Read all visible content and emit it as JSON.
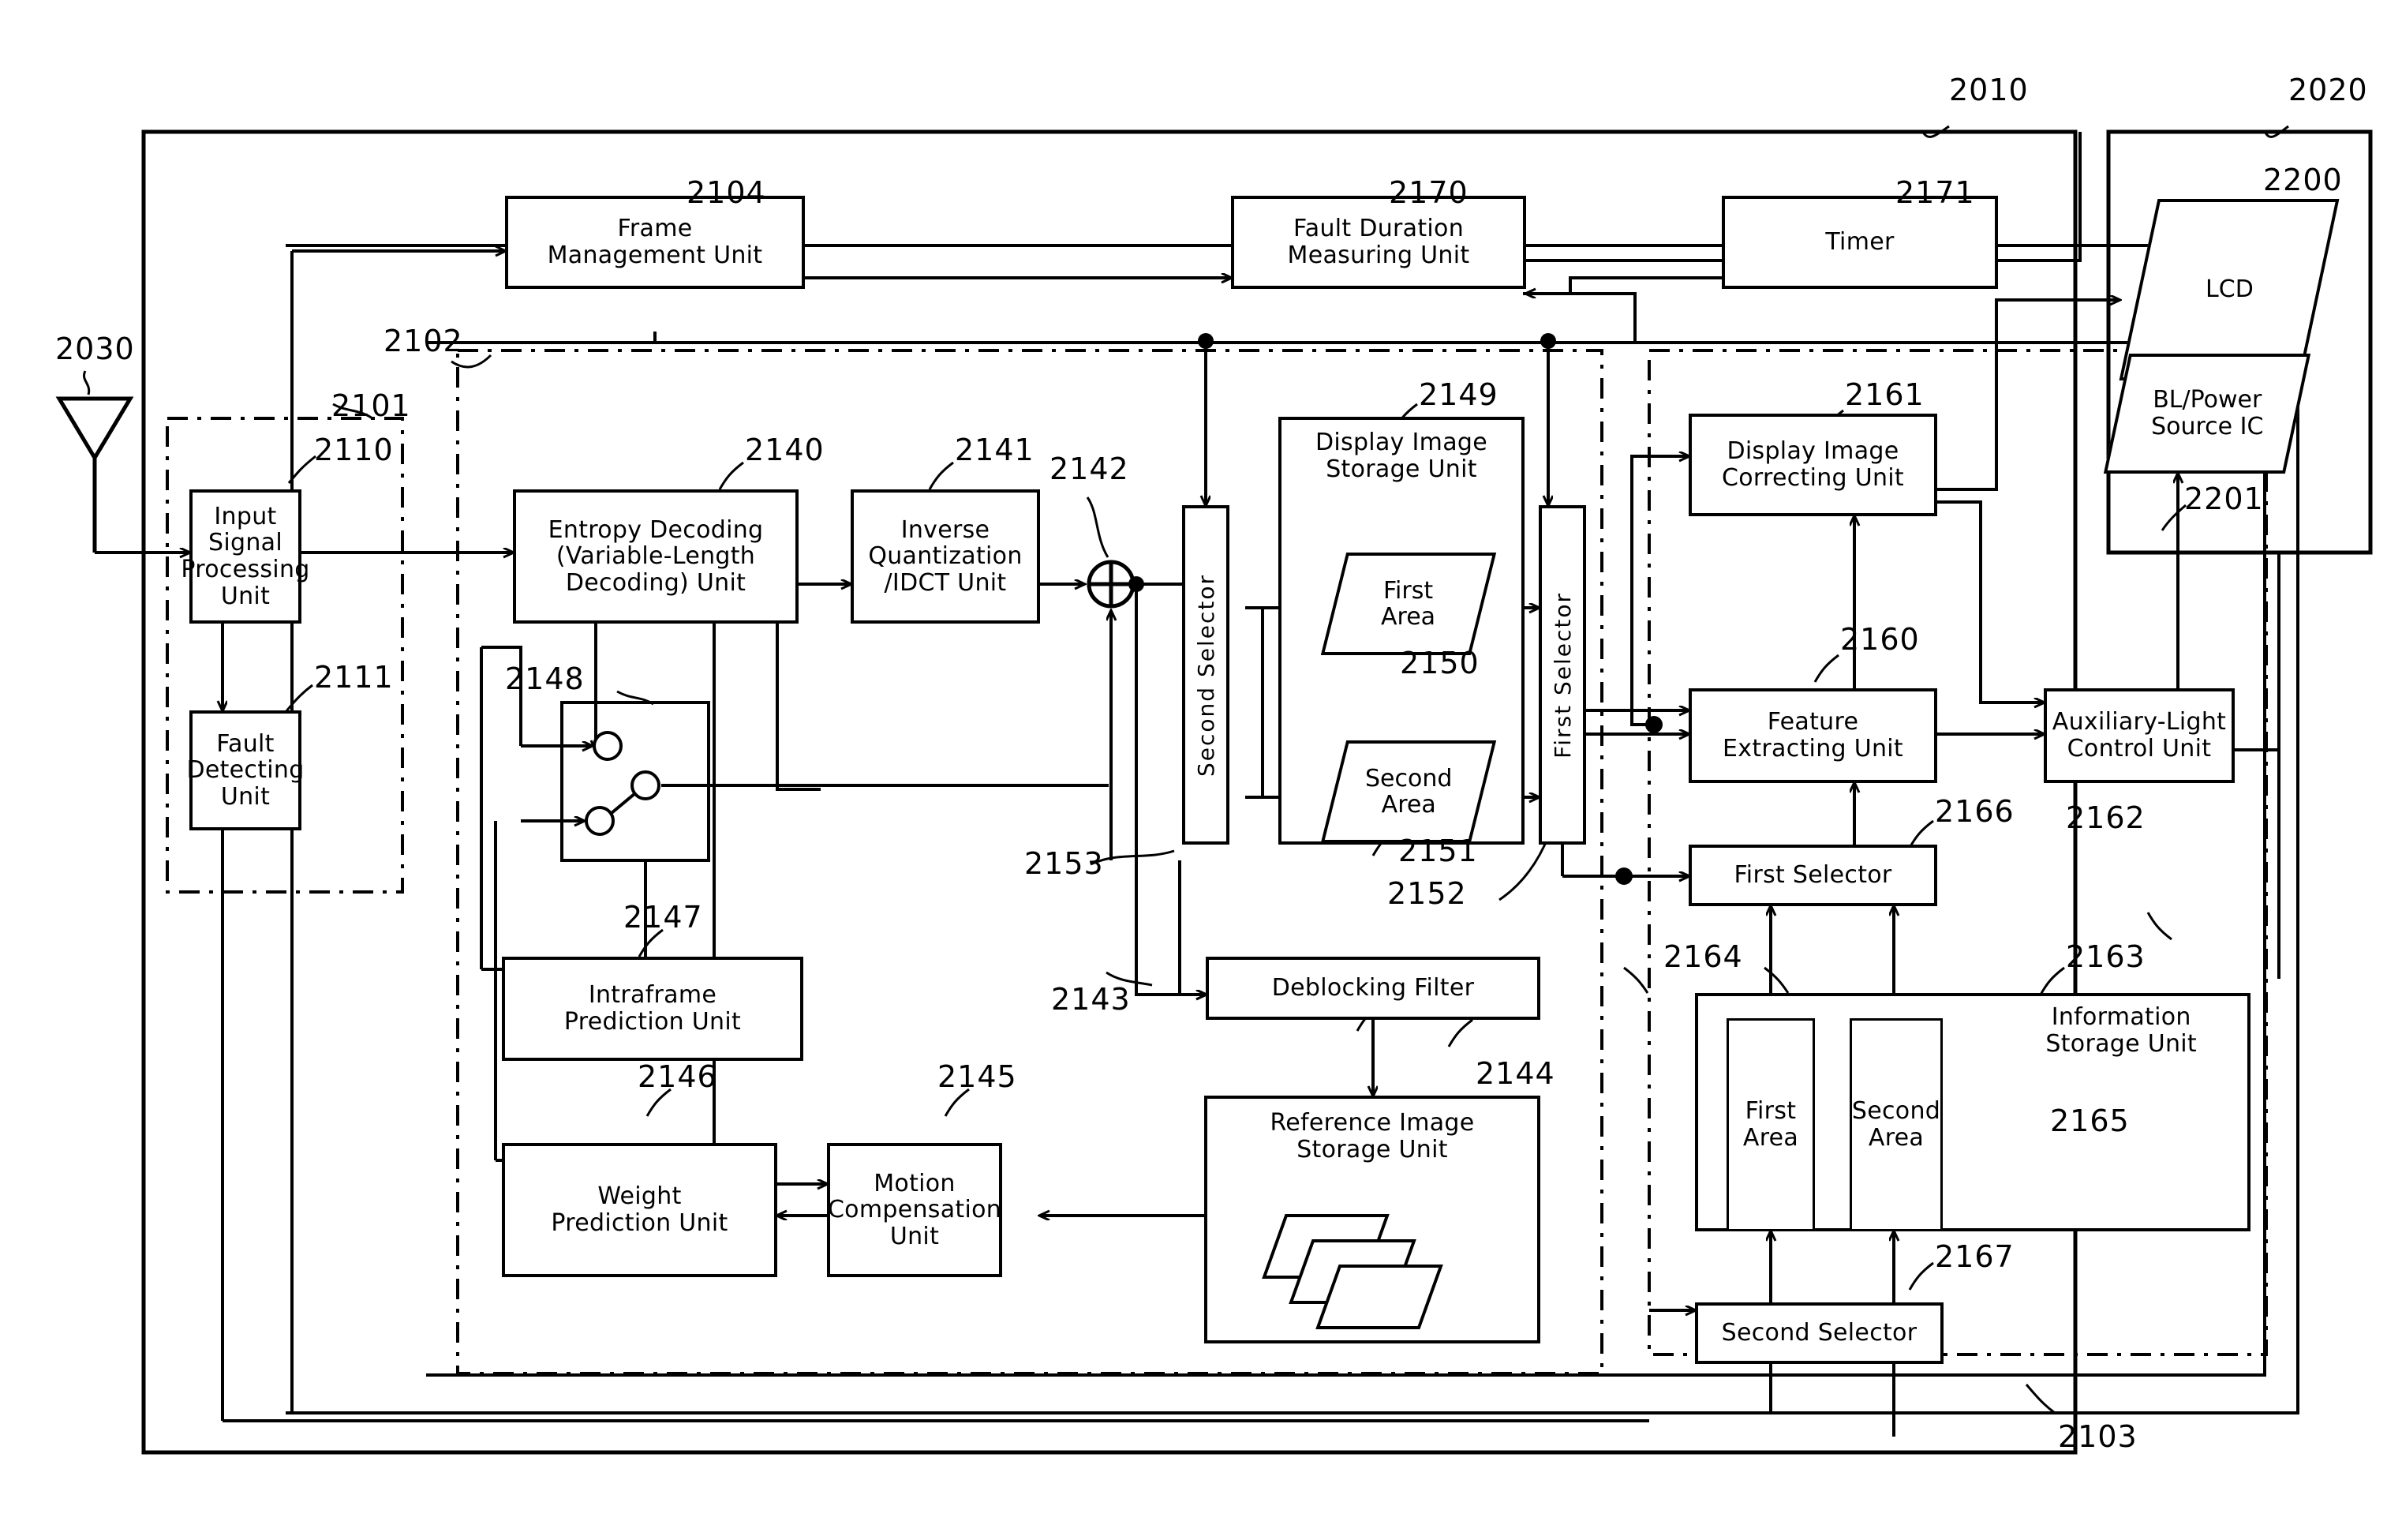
{
  "diagram": {
    "type": "patent-block-diagram",
    "blocks": [
      {
        "id": "2110",
        "label": "Input Signal\nProcessing\nUnit"
      },
      {
        "id": "2111",
        "label": "Fault\nDetecting\nUnit"
      },
      {
        "id": "2104",
        "label": "Frame\nManagement Unit"
      },
      {
        "id": "2170",
        "label": "Fault Duration\nMeasuring Unit"
      },
      {
        "id": "2171",
        "label": "Timer"
      },
      {
        "id": "2140",
        "label": "Entropy Decoding\n(Variable-Length\nDecoding) Unit"
      },
      {
        "id": "2141",
        "label": "Inverse\nQuantization\n/IDCT Unit"
      },
      {
        "id": "2147",
        "label": "Intraframe\nPrediction Unit"
      },
      {
        "id": "2146",
        "label": "Weight\nPrediction Unit"
      },
      {
        "id": "2145",
        "label": "Motion\nCompensation\nUnit"
      },
      {
        "id": "2143",
        "label": "Deblocking Filter"
      },
      {
        "id": "2144",
        "label": "Reference Image\nStorage Unit"
      },
      {
        "id": "2149",
        "label": "Display Image\nStorage Unit"
      },
      {
        "id": "2150",
        "label": "First\nArea"
      },
      {
        "id": "2151",
        "label": "Second\nArea"
      },
      {
        "id": "2153",
        "label": "Second Selector"
      },
      {
        "id": "2152",
        "label": "First Selector"
      },
      {
        "id": "2161",
        "label": "Display Image\nCorrecting Unit"
      },
      {
        "id": "2160",
        "label": "Feature\nExtracting Unit"
      },
      {
        "id": "2162",
        "label": "Auxiliary-Light\nControl Unit"
      },
      {
        "id": "2166",
        "label": "First Selector"
      },
      {
        "id": "2167",
        "label": "Second Selector"
      },
      {
        "id": "2163",
        "label": "Information\nStorage Unit"
      },
      {
        "id": "2164",
        "label": "First\nArea"
      },
      {
        "id": "2165",
        "label": "Second\nArea"
      },
      {
        "id": "2200",
        "label": "LCD"
      },
      {
        "id": "2201",
        "label": "BL/Power\nSource IC"
      }
    ],
    "reference_numerals": [
      "2030",
      "2010",
      "2020",
      "2101",
      "2102",
      "2103",
      "2104",
      "2110",
      "2111",
      "2140",
      "2141",
      "2142",
      "2143",
      "2144",
      "2145",
      "2146",
      "2147",
      "2148",
      "2149",
      "2150",
      "2151",
      "2152",
      "2153",
      "2160",
      "2161",
      "2162",
      "2163",
      "2164",
      "2165",
      "2166",
      "2167",
      "2170",
      "2171",
      "2200",
      "2201"
    ],
    "labels": {
      "antenna": "2030",
      "outer_device": "2010",
      "display_module": "2020",
      "input_section": "2101",
      "decoder_section": "2102",
      "control_section": "2103",
      "frame_management_unit": "2104",
      "input_signal_processing_unit": "2110",
      "fault_detecting_unit": "2111",
      "entropy_decoding_unit": "2140",
      "inverse_quantization_idct_unit": "2141",
      "adder": "2142",
      "deblocking_filter": "2143",
      "reference_image_storage_unit": "2144",
      "motion_compensation_unit": "2145",
      "weight_prediction_unit": "2146",
      "intraframe_prediction_unit": "2147",
      "prediction_switch": "2148",
      "display_image_storage_unit": "2149",
      "display_first_area": "2150",
      "display_second_area": "2151",
      "first_selector_display": "2152",
      "second_selector_display": "2153",
      "feature_extracting_unit": "2160",
      "display_image_correcting_unit": "2161",
      "auxiliary_light_control_unit": "2162",
      "information_storage_unit": "2163",
      "info_first_area": "2164",
      "info_second_area": "2165",
      "first_selector_info": "2166",
      "second_selector_info": "2167",
      "fault_duration_measuring_unit": "2170",
      "timer": "2171",
      "lcd": "2200",
      "bl_power_source_ic": "2201"
    },
    "text": {
      "input_signal_processing_unit": "Input Signal\nProcessing\nUnit",
      "fault_detecting_unit": "Fault\nDetecting\nUnit",
      "frame_management_unit": "Frame\nManagement Unit",
      "fault_duration_measuring_unit": "Fault Duration\nMeasuring Unit",
      "timer": "Timer",
      "entropy_decoding_unit": "Entropy Decoding\n(Variable-Length\nDecoding) Unit",
      "inverse_quantization_idct_unit": "Inverse\nQuantization\n/IDCT Unit",
      "intraframe_prediction_unit": "Intraframe\nPrediction Unit",
      "weight_prediction_unit": "Weight\nPrediction Unit",
      "motion_compensation_unit": "Motion\nCompensation\nUnit",
      "deblocking_filter": "Deblocking Filter",
      "reference_image_storage_unit": "Reference Image\nStorage Unit",
      "display_image_storage_unit": "Display Image\nStorage Unit",
      "display_first_area": "First\nArea",
      "display_second_area": "Second\nArea",
      "second_selector_display": "Second Selector",
      "first_selector_display": "First Selector",
      "display_image_correcting_unit": "Display Image\nCorrecting Unit",
      "feature_extracting_unit": "Feature\nExtracting Unit",
      "auxiliary_light_control_unit": "Auxiliary-Light\nControl Unit",
      "first_selector_info": "First Selector",
      "second_selector_info": "Second Selector",
      "information_storage_unit": "Information\nStorage Unit",
      "info_first_area": "First\nArea",
      "info_second_area": "Second\nArea",
      "lcd": "LCD",
      "bl_power_source_ic": "BL/Power\nSource IC"
    },
    "colors": {
      "line": "#000000",
      "background": "#ffffff"
    }
  }
}
